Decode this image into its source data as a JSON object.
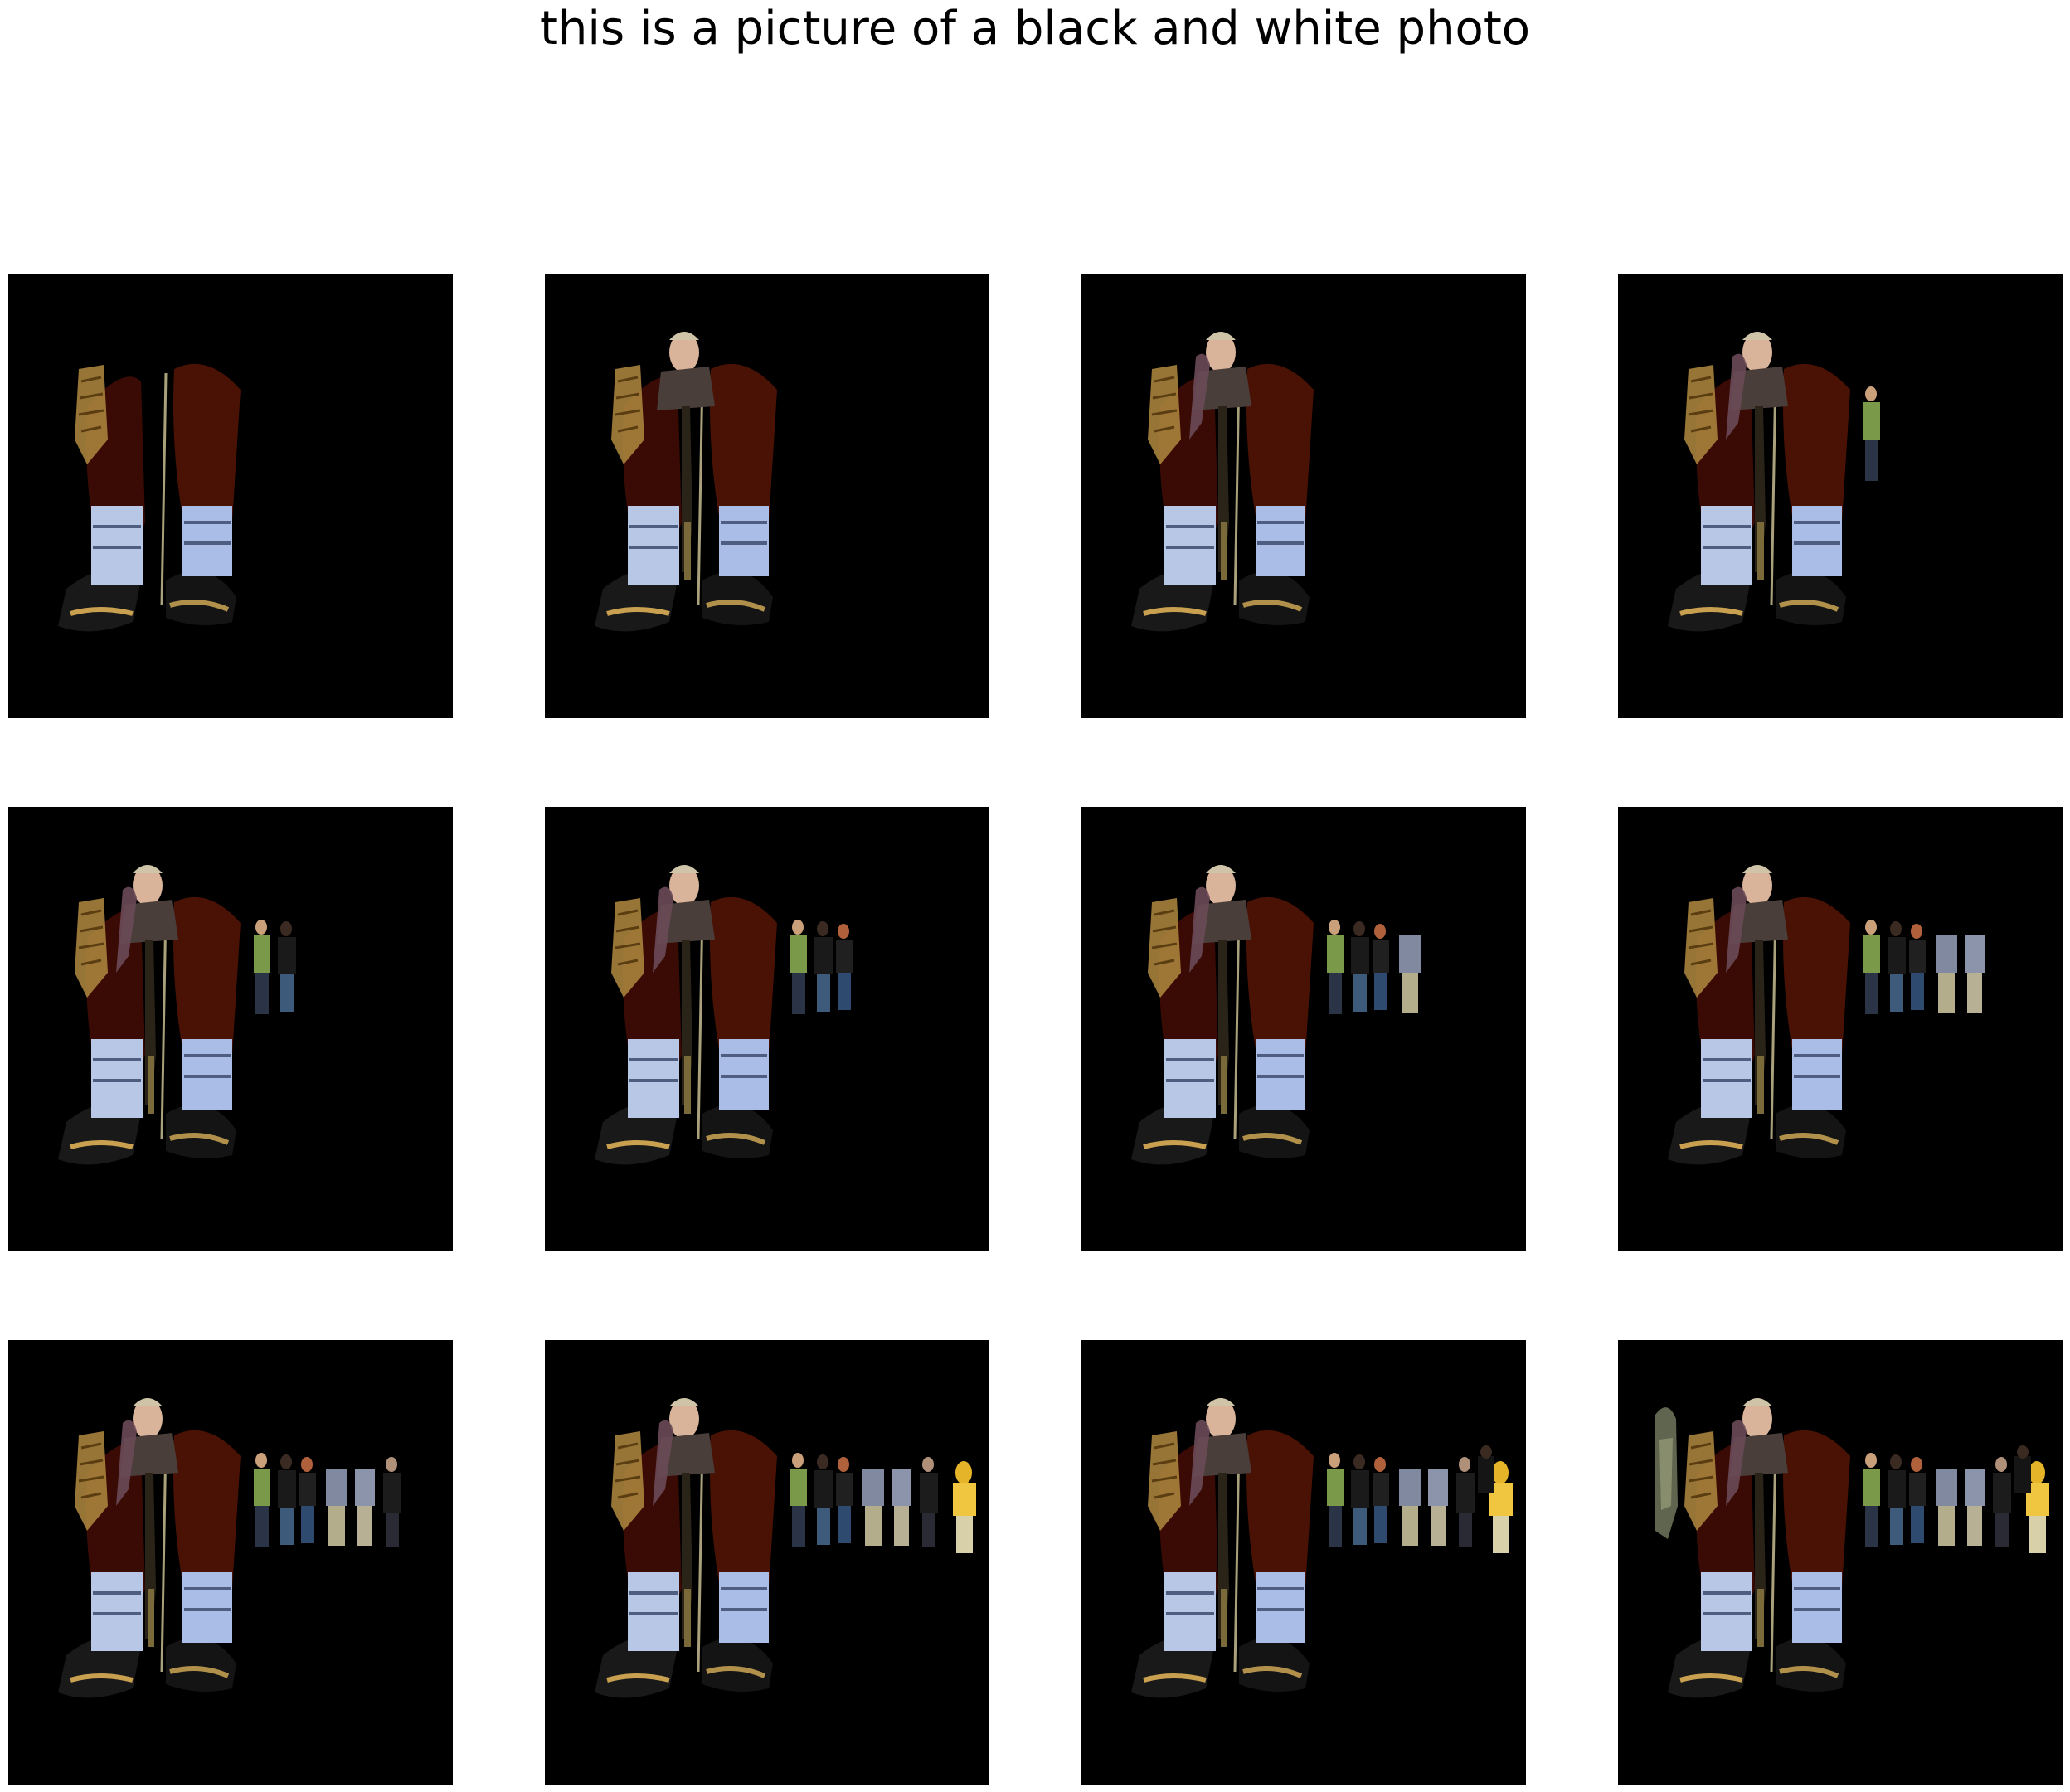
{
  "figure": {
    "title": "this is a picture of a black and white photo"
  },
  "colors": {
    "page_background": "#ffffff",
    "panel_background": "#000000",
    "title_text": "#000000"
  },
  "panels": [
    {
      "index": 1,
      "revealed_segments": [
        "legs",
        "shoes",
        "socks",
        "left-basket"
      ]
    },
    {
      "index": 2,
      "revealed_segments": [
        "legs",
        "shoes",
        "socks",
        "left-basket",
        "man-face",
        "middle-figure"
      ]
    },
    {
      "index": 3,
      "revealed_segments": [
        "legs",
        "shoes",
        "socks",
        "left-basket",
        "man-face",
        "middle-figure",
        "arm"
      ]
    },
    {
      "index": 4,
      "revealed_segments": [
        "legs",
        "shoes",
        "socks",
        "left-basket",
        "man-face",
        "middle-figure",
        "arm",
        "person-1"
      ]
    },
    {
      "index": 5,
      "revealed_segments": [
        "legs",
        "shoes",
        "socks",
        "left-basket",
        "man-face",
        "middle-figure",
        "arm",
        "person-1",
        "person-2"
      ]
    },
    {
      "index": 6,
      "revealed_segments": [
        "legs",
        "shoes",
        "socks",
        "left-basket",
        "man-face",
        "middle-figure",
        "arm",
        "person-1",
        "person-2",
        "person-3"
      ]
    },
    {
      "index": 7,
      "revealed_segments": [
        "legs",
        "shoes",
        "socks",
        "left-basket",
        "man-face",
        "middle-figure",
        "arm",
        "person-1",
        "person-2",
        "person-3",
        "person-4"
      ]
    },
    {
      "index": 8,
      "revealed_segments": [
        "legs",
        "shoes",
        "socks",
        "left-basket",
        "man-face",
        "middle-figure",
        "arm",
        "person-1",
        "person-2",
        "person-3",
        "person-4",
        "person-5"
      ]
    },
    {
      "index": 9,
      "revealed_segments": [
        "legs",
        "shoes",
        "socks",
        "left-basket",
        "man-face",
        "middle-figure",
        "arm",
        "person-1",
        "person-2",
        "person-3",
        "person-4",
        "person-5",
        "person-6"
      ]
    },
    {
      "index": 10,
      "revealed_segments": [
        "legs",
        "shoes",
        "socks",
        "left-basket",
        "man-face",
        "middle-figure",
        "arm",
        "person-1",
        "person-2",
        "person-3",
        "person-4",
        "person-5",
        "person-6",
        "person-yellow"
      ]
    },
    {
      "index": 11,
      "revealed_segments": [
        "legs",
        "shoes",
        "socks",
        "left-basket",
        "man-face",
        "middle-figure",
        "arm",
        "person-1",
        "person-2",
        "person-3",
        "person-4",
        "person-5",
        "person-6",
        "person-yellow",
        "person-7"
      ]
    },
    {
      "index": 12,
      "revealed_segments": [
        "legs",
        "shoes",
        "socks",
        "left-basket",
        "man-face",
        "middle-figure",
        "arm",
        "person-1",
        "person-2",
        "person-3",
        "person-4",
        "person-5",
        "person-6",
        "person-yellow",
        "person-7",
        "left-figure"
      ]
    }
  ]
}
